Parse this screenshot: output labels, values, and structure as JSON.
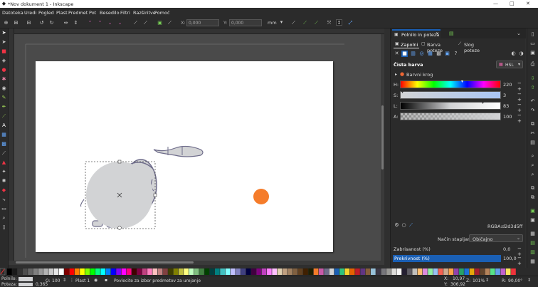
{
  "window": {
    "title": "*Nov dokument 1 - Inkscape"
  },
  "menu": [
    "Datoteka",
    "Uredi",
    "Pogled",
    "Plast",
    "Predmet",
    "Pot",
    "Besedilo",
    "Filtri",
    "Razširitve",
    "Pomoč"
  ],
  "toolbar": {
    "x_label": "X:",
    "x_value": "0,000",
    "y_label": "Y:",
    "y_value": "0,000",
    "unit": "mm"
  },
  "panel": {
    "tab_title": "Polnilo in poteza",
    "subtabs": [
      "Zapolni",
      "Barva poteze",
      "Slog poteze"
    ],
    "fill_type": "Čista barva",
    "color_mode": "HSL",
    "wheel_label": "Barvni krog",
    "sliders": [
      {
        "label": "H:",
        "value": "220"
      },
      {
        "label": "S:",
        "value": "3"
      },
      {
        "label": "L:",
        "value": "83"
      },
      {
        "label": "A:",
        "value": "100"
      }
    ],
    "rgba_label": "RGBA:",
    "rgba_value": "d2d3d5ff",
    "blend_label": "Način stapljanja:",
    "blend_value": "Običajno",
    "blur_label": "Zabrisanost (%)",
    "blur_value": "0,0",
    "opacity_label": "Prekrivnost (%)",
    "opacity_value": "100,0"
  },
  "status": {
    "fill_label": "Polnilo:",
    "stroke_label": "Poteza:",
    "stroke_width": "0,365",
    "opacity_label": "O:",
    "opacity_value": "100",
    "layer": "Plast 1",
    "message": "Povlecite za izbor predmetov za urejanje",
    "x_label": "X:",
    "x_value": "10,97",
    "y_label": "Y:",
    "y_value": "306,92",
    "zoom_label": "Z:",
    "zoom_value": "101%",
    "rotation_label": "R:",
    "rotation_value": "90,00°"
  },
  "colors": {
    "accent": "#1a5fb4",
    "orange": "#f57c2a",
    "selection_fill": "#d2d3d5"
  }
}
